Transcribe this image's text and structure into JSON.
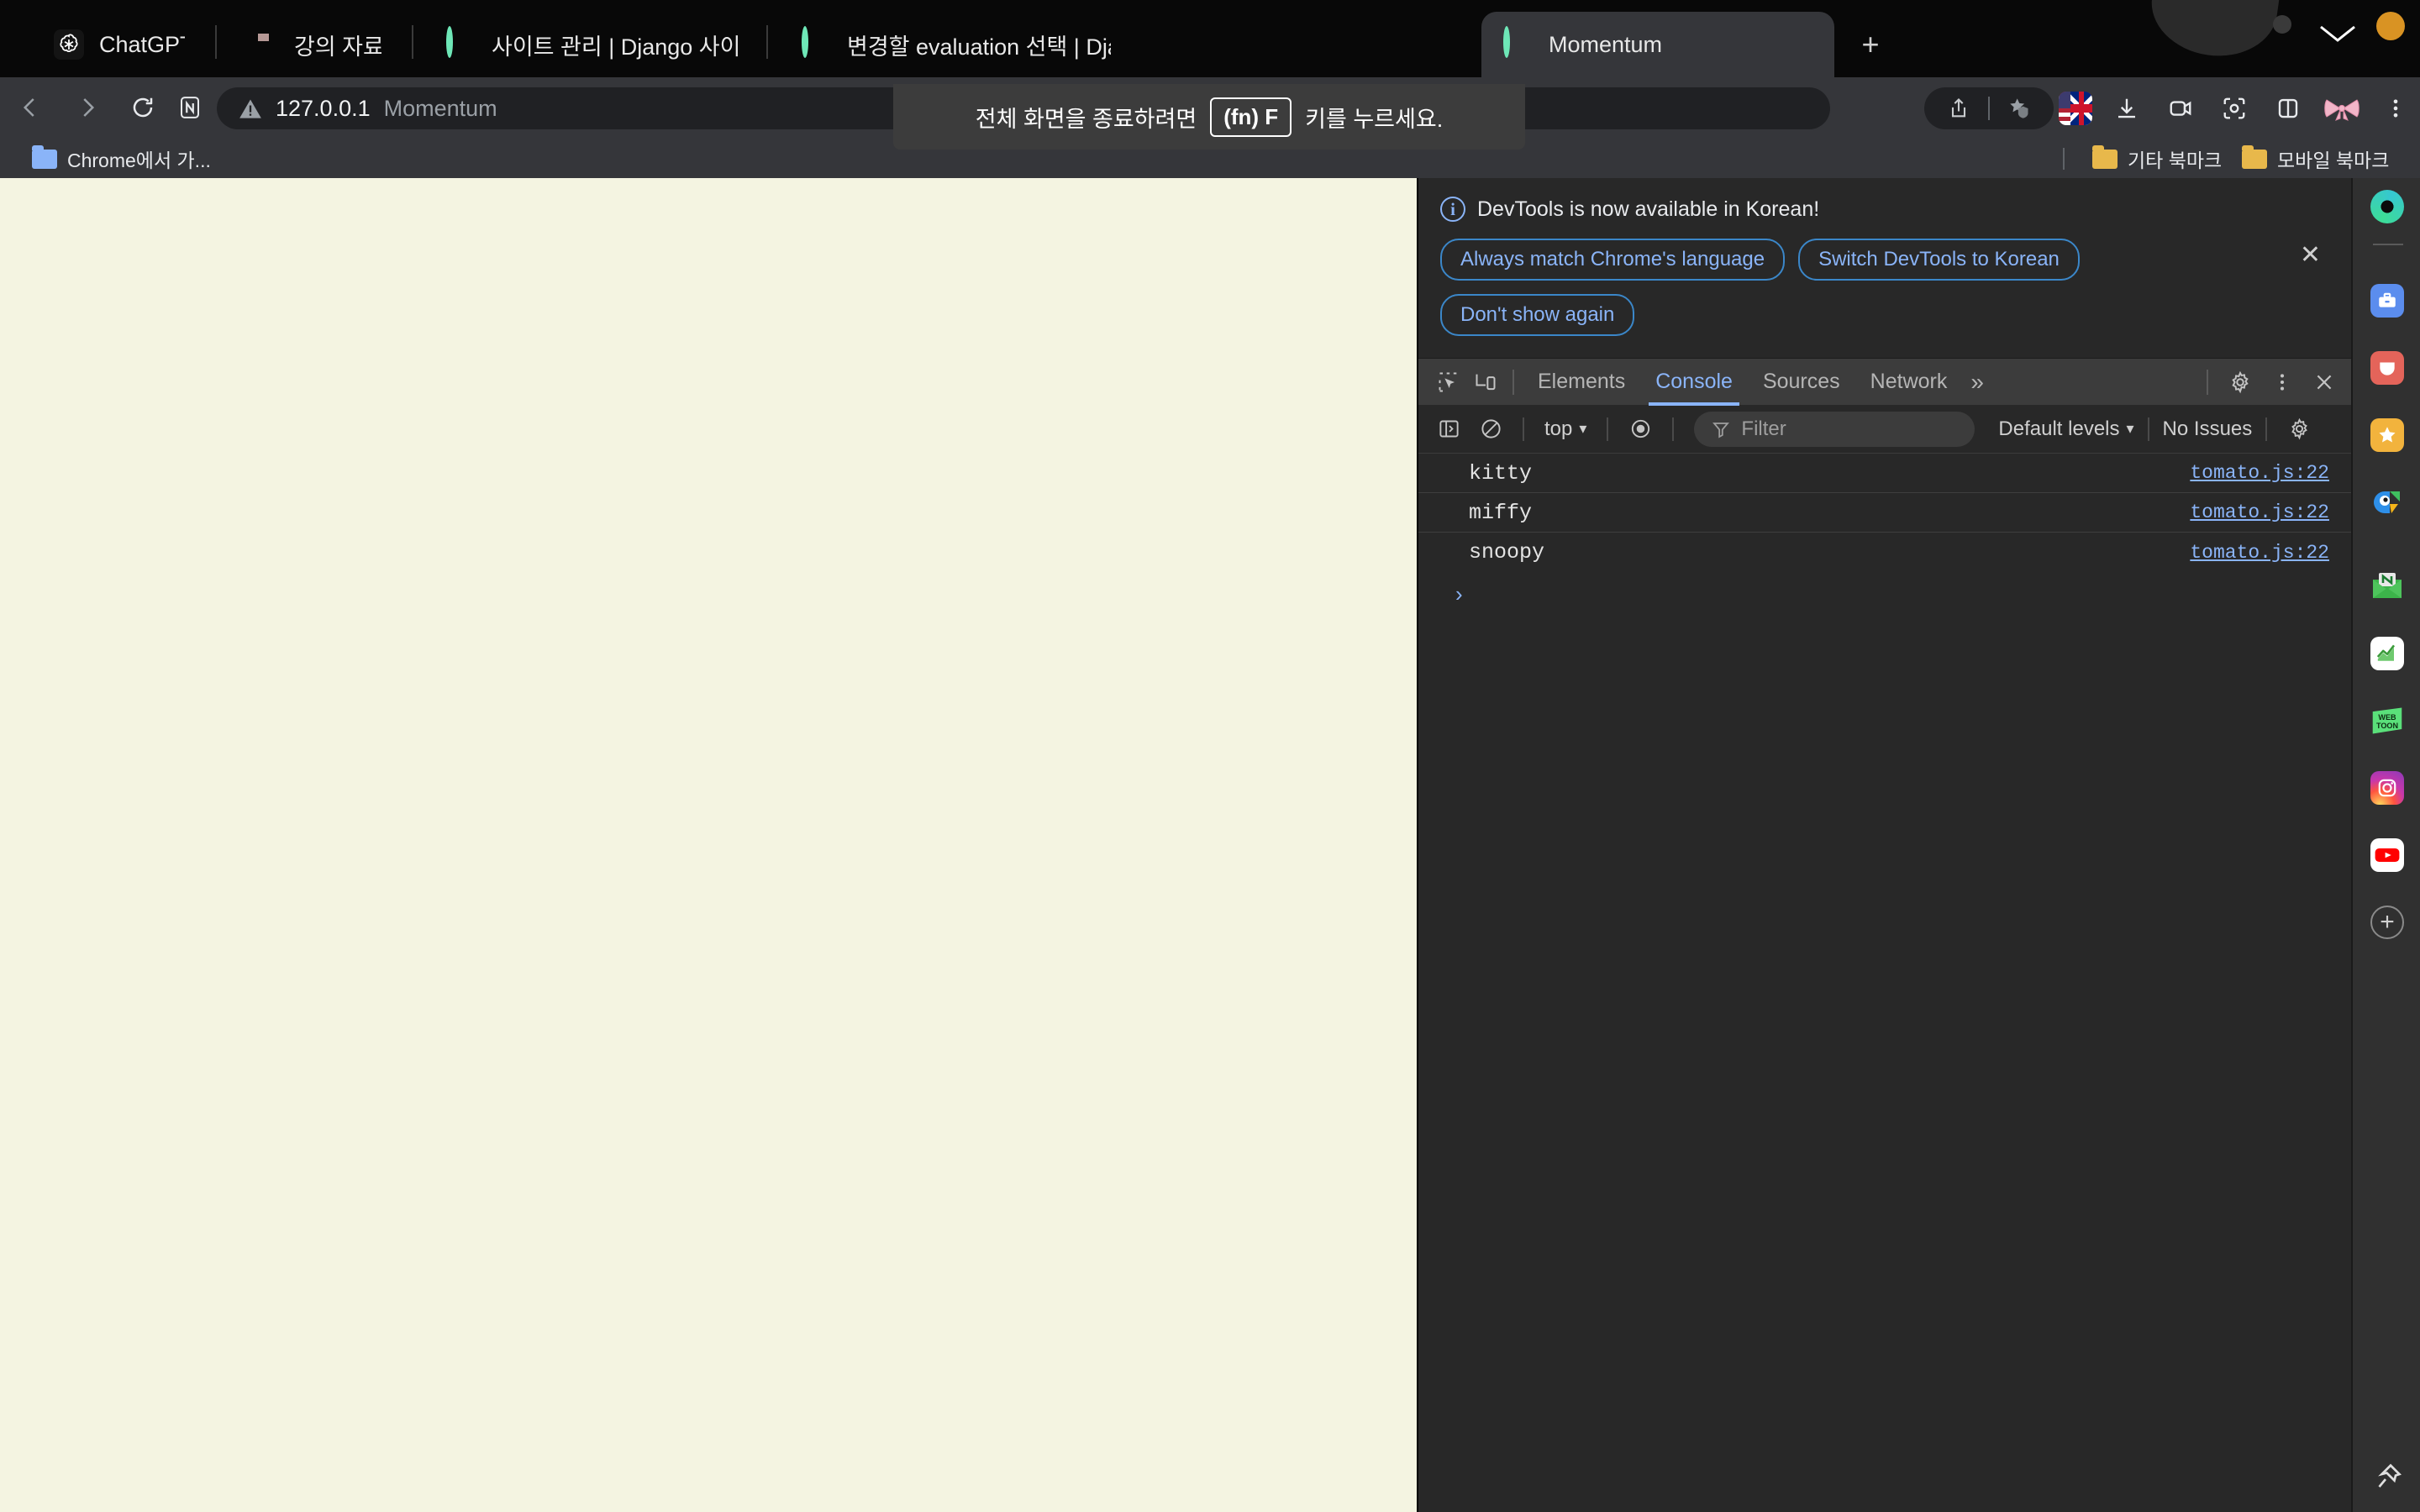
{
  "browser": {
    "tabs": [
      {
        "title": "ChatGPT",
        "icon": "chatgpt-logo-icon",
        "active": false
      },
      {
        "title": "강의 자료",
        "icon": "red-book-icon",
        "active": false
      },
      {
        "title": "사이트 관리 | Django 사이트 관리",
        "icon": "green-ring-icon",
        "active": false
      },
      {
        "title": "변경할 evaluation 선택 | Django",
        "icon": "green-ring-icon",
        "active": false
      },
      {
        "title": "Momentum",
        "icon": "green-ring-icon",
        "active": true
      }
    ],
    "new_tab_label": "+",
    "omnibox": {
      "host": "127.0.0.1",
      "rest": "Momentum",
      "security_icon": "not-secure-warning-icon"
    },
    "nav": {
      "back": "back-icon",
      "forward": "forward-icon",
      "reload": "reload-icon",
      "naver_button": "naver-n-icon"
    },
    "toolbar_icons": [
      "share-icon",
      "star-shield-icon",
      "language-flag-icon",
      "download-icon",
      "video-capture-icon",
      "screenshot-icon",
      "split-view-icon",
      "pink-ribbon-icon",
      "chrome-menu-icon"
    ],
    "bookmarks_left": [
      {
        "label": "Chrome에서 가...",
        "icon": "blue-folder-icon"
      }
    ],
    "bookmarks_right": [
      {
        "label": "기타 북마크",
        "icon": "yellow-folder-icon"
      },
      {
        "label": "모바일 북마크",
        "icon": "yellow-folder-icon"
      }
    ]
  },
  "fullscreen_toast": {
    "prefix": "전체 화면을 종료하려면",
    "key": "(fn) F",
    "suffix": "키를 누르세요."
  },
  "devtools": {
    "notice": {
      "message": "DevTools is now available in Korean!",
      "buttons": [
        "Always match Chrome's language",
        "Switch DevTools to Korean",
        "Don't show again"
      ],
      "close_label": "✕"
    },
    "tabs": [
      {
        "label": "Elements",
        "active": false
      },
      {
        "label": "Console",
        "active": true
      },
      {
        "label": "Sources",
        "active": false
      },
      {
        "label": "Network",
        "active": false
      }
    ],
    "more_tabs_label": "»",
    "left_icons": [
      "inspect-element-icon",
      "device-toolbar-icon"
    ],
    "right_icons": [
      "settings-gear-icon",
      "devtools-menu-icon",
      "close-devtools-icon"
    ],
    "console_toolbar": {
      "sidebar_toggle": "console-sidebar-icon",
      "clear_label": "clear-console-icon",
      "context": "top",
      "eye_icon": "live-expression-icon",
      "filter_placeholder": "Filter",
      "filter_value": "",
      "levels": "Default levels",
      "issues": "No Issues",
      "settings": "console-settings-icon"
    },
    "messages": [
      {
        "text": "kitty",
        "source": "tomato.js:22"
      },
      {
        "text": "miffy",
        "source": "tomato.js:22"
      },
      {
        "text": "snoopy",
        "source": "tomato.js:22"
      }
    ],
    "prompt_symbol": "›"
  },
  "app_rail": {
    "items": [
      {
        "name": "whale-browser-icon"
      },
      {
        "name": "toolbox-icon"
      },
      {
        "name": "pocket-icon"
      },
      {
        "name": "star-bookmark-icon"
      },
      {
        "name": "naver-whale-icon"
      },
      {
        "name": "naver-mail-icon"
      },
      {
        "name": "naver-chart-icon"
      },
      {
        "name": "webtoon-icon"
      },
      {
        "name": "instagram-icon"
      },
      {
        "name": "youtube-icon"
      },
      {
        "name": "add-app-icon"
      }
    ],
    "webtoon_text": [
      "WEB",
      "TOON"
    ],
    "pin_icon": "pin-icon"
  },
  "colors": {
    "page_background": "#f4f4e1",
    "devtools_background": "#282828",
    "chrome_toolbar": "#35363a",
    "accent_blue": "#8ab4f8",
    "tab_accent_green": "#6ee7b7"
  }
}
